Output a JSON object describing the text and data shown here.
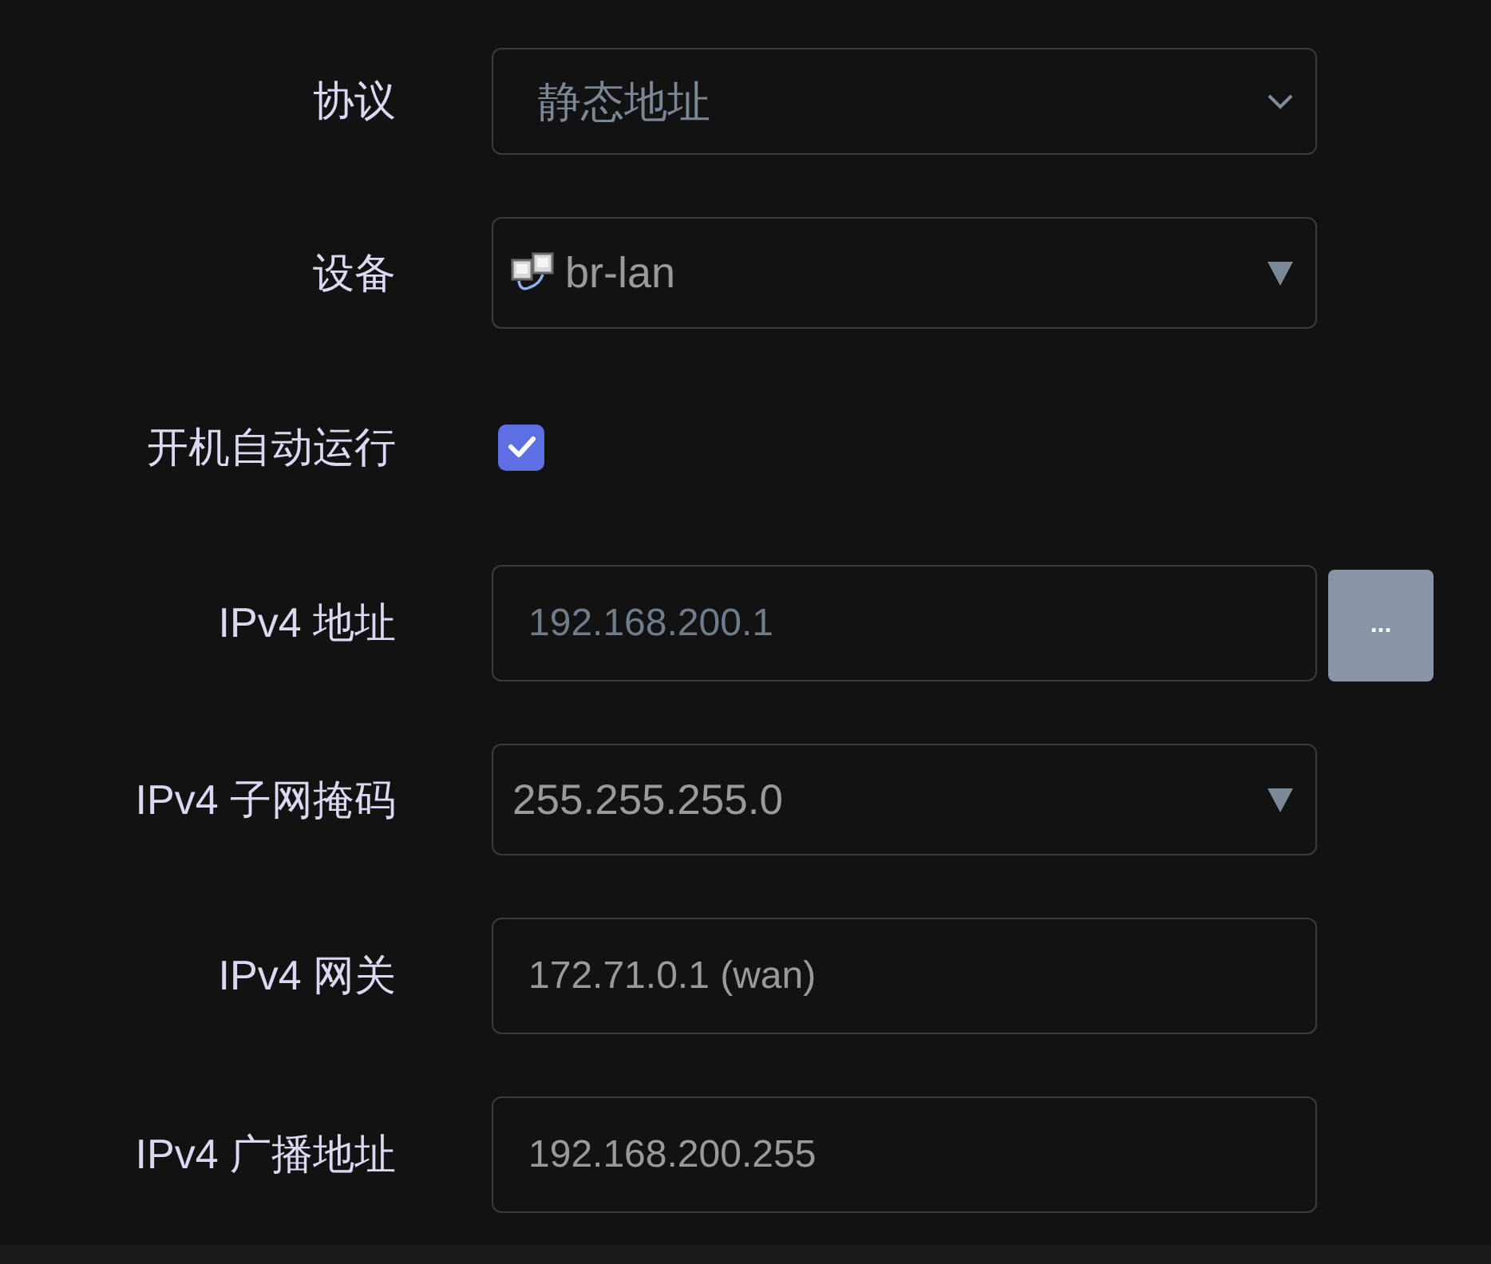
{
  "fields": [
    {
      "kind": "select",
      "label": "协议",
      "value": "静态地址"
    },
    {
      "kind": "device",
      "label": "设备",
      "value": "br-lan"
    },
    {
      "kind": "checkbox",
      "label": "开机自动运行",
      "checked": true
    },
    {
      "kind": "input",
      "label": "IPv4 地址",
      "value": "192.168.200.1",
      "button": "..."
    },
    {
      "kind": "combo",
      "label": "IPv4 子网掩码",
      "value": "255.255.255.0"
    },
    {
      "kind": "input",
      "label": "IPv4 网关",
      "placeholder": "172.71.0.1 (wan)"
    },
    {
      "kind": "input",
      "label": "IPv4 广播地址",
      "placeholder": "192.168.200.255"
    }
  ]
}
